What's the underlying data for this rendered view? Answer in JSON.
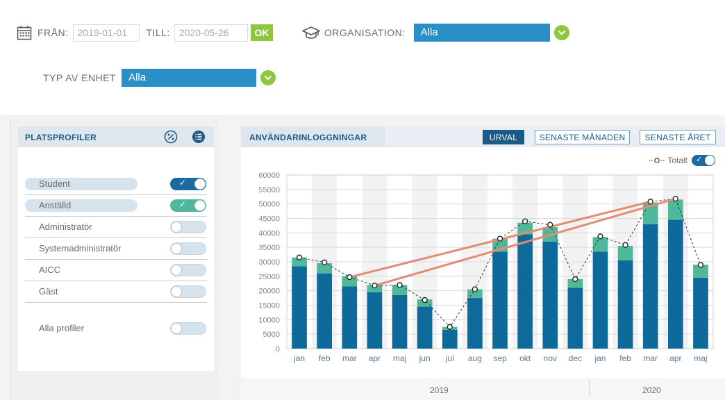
{
  "filters": {
    "from_label": "FRÅN:",
    "from_value": "2019-01-01",
    "till_label": "TILL:",
    "till_value": "2020-05-26",
    "ok_label": "OK",
    "org_label": "ORGANISATION:",
    "org_value": "Alla",
    "unit_type_label": "TYP AV ENHET",
    "unit_type_value": "Alla"
  },
  "left_panel": {
    "title": "PLATSPROFILER",
    "profiles": [
      {
        "label": "Student",
        "active": true,
        "color": "blue"
      },
      {
        "label": "Anställd",
        "active": true,
        "color": "teal"
      },
      {
        "label": "Administratör",
        "active": false
      },
      {
        "label": "Systemadministratör",
        "active": false
      },
      {
        "label": "AICC",
        "active": false
      },
      {
        "label": "Gäst",
        "active": false
      }
    ],
    "all_profiles_label": "Alla profiler",
    "all_profiles_active": false
  },
  "right_panel": {
    "title": "ANVÄNDARINLOGGNINGAR",
    "btn_urval": "URVAL",
    "btn_last_month": "SENASTE MÅNADEN",
    "btn_last_year": "SENASTE ÅRET",
    "legend_total": "Totalt",
    "legend_total_active": true,
    "year_2019": "2019",
    "year_2020": "2020"
  },
  "colors": {
    "accent_blue": "#2b8fc7",
    "accent_green": "#8dc63f",
    "bar_student": "#0f6a9c",
    "bar_employee": "#4fb89a",
    "trend_line": "#e58a73"
  },
  "chart_data": {
    "type": "bar",
    "categories": [
      "jan",
      "feb",
      "mar",
      "apr",
      "maj",
      "jun",
      "jul",
      "aug",
      "sep",
      "okt",
      "nov",
      "dec",
      "jan",
      "feb",
      "mar",
      "apr",
      "maj"
    ],
    "series": [
      {
        "name": "Student",
        "values": [
          28500,
          26000,
          21500,
          19500,
          18500,
          14500,
          6500,
          17500,
          33500,
          39500,
          37000,
          21000,
          33500,
          30500,
          43000,
          44500,
          24500
        ]
      },
      {
        "name": "Anställd",
        "values": [
          3000,
          3500,
          3500,
          2500,
          3500,
          2500,
          1000,
          3000,
          4500,
          4000,
          5000,
          3000,
          5000,
          5000,
          7500,
          7000,
          4500
        ]
      },
      {
        "name": "Totalt",
        "values": [
          31500,
          29800,
          24700,
          21800,
          22000,
          16800,
          7500,
          20500,
          38000,
          44000,
          42800,
          24000,
          38800,
          35800,
          50800,
          51800,
          28900
        ]
      }
    ],
    "ylim": [
      0,
      60000
    ],
    "yticks": [
      0,
      5000,
      10000,
      15000,
      20000,
      25000,
      30000,
      35000,
      40000,
      45000,
      50000,
      55000,
      60000
    ],
    "stacked": true,
    "grid": true,
    "annotations": [
      {
        "type": "line",
        "from": "mar",
        "to": "mar",
        "from_index": 2,
        "to_index": 14,
        "from_value": 24700,
        "to_value": 50800
      },
      {
        "type": "line",
        "from": "apr",
        "to": "apr",
        "from_index": 3,
        "to_index": 15,
        "from_value": 21800,
        "to_value": 51800
      }
    ]
  }
}
